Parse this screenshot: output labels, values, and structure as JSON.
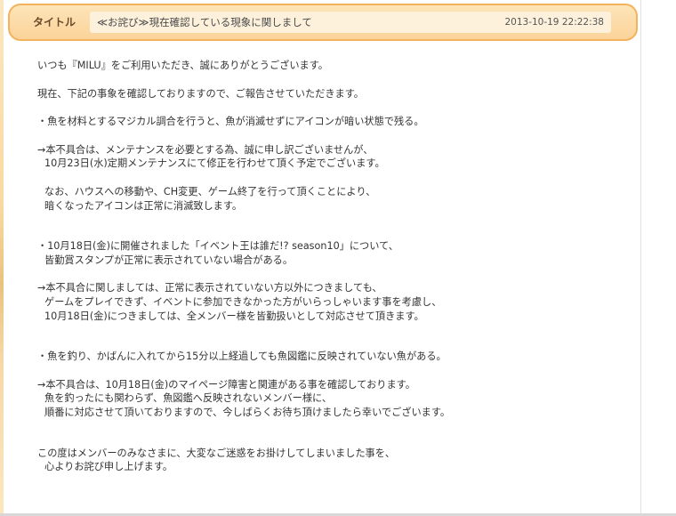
{
  "header": {
    "label": "タイトル",
    "subject": "≪お詫び≫現在確認している現象に関しまして",
    "date": "2013-10-19 22:22:38"
  },
  "body": {
    "greeting": "いつも『MILU』をご利用いただき、誠にありがとうございます。",
    "intro": "現在、下記の事象を確認しておりますので、ご報告させていただきます。",
    "issue1": {
      "title": "・魚を材料とするマジカル調合を行うと、魚が消滅せずにアイコンが暗い状態で残る。",
      "response_line1": "→本不具合は、メンテナンスを必要とする為、誠に申し訳ございませんが、",
      "response_line2": "10月23日(水)定期メンテナンスにて修正を行わせて頂く予定でございます。",
      "note_line1": "なお、ハウスへの移動や、CH変更、ゲーム終了を行って頂くことにより、",
      "note_line2": "暗くなったアイコンは正常に消滅致します。"
    },
    "issue2": {
      "title_line1": "・10月18日(金)に開催されました「イベント王は誰だ!? season10」について、",
      "title_line2": "皆勤賞スタンプが正常に表示されていない場合がある。",
      "response_line1": "→本不具合に関しましては、正常に表示されていない方以外につきましても、",
      "response_line2": "ゲームをプレイできず、イベントに参加できなかった方がいらっしゃいます事を考慮し、",
      "response_line3": "10月18日(金)につきましては、全メンバー様を皆勤扱いとして対応させて頂きます。"
    },
    "issue3": {
      "title": "・魚を釣り、かばんに入れてから15分以上経過しても魚図鑑に反映されていない魚がある。",
      "response_line1": "→本不具合は、10月18日(金)のマイページ障害と関連がある事を確認しております。",
      "response_line2": "魚を釣ったにも関わらず、魚図鑑へ反映されないメンバー様に、",
      "response_line3": "順番に対応させて頂いておりますので、今しばらくお待ち頂けましたら幸いでございます。"
    },
    "closing_line1": "この度はメンバーのみなさまに、大変なご迷惑をお掛けしてしまいました事を、",
    "closing_line2": "心よりお詫び申し上げます。"
  },
  "colors": {
    "header_border": "#f3b35c",
    "header_fill": "#fbd39a",
    "header_field": "#fdf1dc",
    "body_text": "#333333"
  }
}
